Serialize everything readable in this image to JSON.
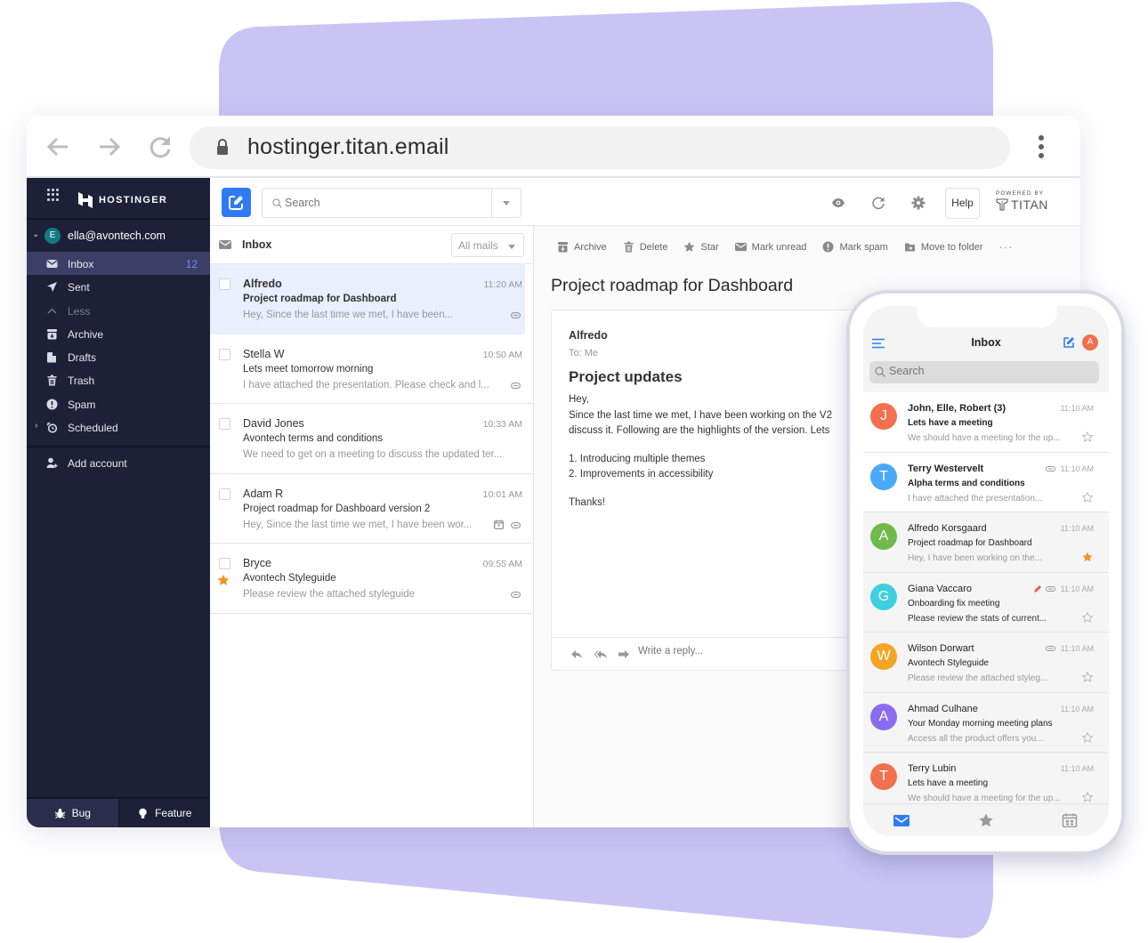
{
  "browser": {
    "url": "hostinger.titan.email",
    "nav": {
      "back": "arrow-left",
      "forward": "arrow-right",
      "reload": "reload"
    }
  },
  "sidebar": {
    "brand": "HOSTINGER",
    "account": {
      "initial": "E",
      "email": "ella@avontech.com"
    },
    "folders": [
      {
        "label": "Inbox",
        "icon": "envelope",
        "count": "12",
        "active": true
      },
      {
        "label": "Sent",
        "icon": "paper-plane"
      },
      {
        "label": "Less",
        "icon": "chevron-up"
      },
      {
        "label": "Archive",
        "icon": "archive-box"
      },
      {
        "label": "Drafts",
        "icon": "draft-page"
      },
      {
        "label": "Trash",
        "icon": "trash"
      },
      {
        "label": "Spam",
        "icon": "exclamation-circle"
      },
      {
        "label": "Scheduled",
        "icon": "alarm-clock"
      }
    ],
    "add_account": "Add account",
    "footer": {
      "bug": "Bug",
      "feature": "Feature"
    }
  },
  "toolbar": {
    "search_placeholder": "Search",
    "help": "Help",
    "powered_by": "POWERED BY",
    "titan": "TITAN"
  },
  "mail_list": {
    "title": "Inbox",
    "filter": "All mails",
    "items": [
      {
        "from": "Alfredo",
        "time": "11:20 AM",
        "subject": "Project roadmap for Dashboard",
        "preview": "Hey, Since the last time we met, I have been...",
        "attachment": true,
        "unread": true,
        "selected": true
      },
      {
        "from": "Stella W",
        "time": "10:50 AM",
        "subject": "Lets meet tomorrow morning",
        "preview": "I have attached the presentation. Please check and l...",
        "attachment": true
      },
      {
        "from": "David Jones",
        "time": "10:33 AM",
        "subject": "Avontech terms and conditions",
        "preview": "We need to get on a meeting to discuss the updated ter..."
      },
      {
        "from": "Adam R",
        "time": "10:01 AM",
        "subject": "Project roadmap for Dashboard version 2",
        "preview": "Hey, Since the last time we met, I have been wor...",
        "attachment": true,
        "calendar": true
      },
      {
        "from": "Bryce",
        "time": "09:55 AM",
        "subject": "Avontech Styleguide",
        "preview": "Please review the attached styleguide",
        "attachment": true,
        "starred": true
      }
    ]
  },
  "reader": {
    "actions": [
      "Archive",
      "Delete",
      "Star",
      "Mark unread",
      "Mark spam",
      "Move to folder"
    ],
    "subject": "Project roadmap for Dashboard",
    "from": "Alfredo",
    "to": "To: Me",
    "heading": "Project updates",
    "body": {
      "greeting": "Hey,",
      "line1": "Since the last time we met, I have been working on the V2",
      "line2": "discuss it. Following are the highlights of the version. Lets",
      "point1": "1. Introducing multiple themes",
      "point2": "2. Improvements in accessibility",
      "signoff": "Thanks!"
    },
    "reply_placeholder": "Write a reply..."
  },
  "phone": {
    "title": "Inbox",
    "avatar": "A",
    "search_placeholder": "Search",
    "items": [
      {
        "initial": "J",
        "color": "#f2704f",
        "from": "John, Elle, Robert (3)",
        "time": "11:10 AM",
        "subject": "Lets have a meeting",
        "preview": "We should have a meeting for the up...",
        "unread": true
      },
      {
        "initial": "T",
        "color": "#4aa8f7",
        "from": "Terry Westervelt",
        "time": "11:10 AM",
        "subject": "Alpha terms and conditions",
        "preview": "I have attached the presentation...",
        "unread": true,
        "attachment": true
      },
      {
        "initial": "A",
        "color": "#72b94c",
        "from": "Alfredo Korsgaard",
        "time": "11:10 AM",
        "subject": "Project roadmap for Dashboard",
        "preview": "Hey, I have been working on the...",
        "starred": true
      },
      {
        "initial": "G",
        "color": "#3ed0de",
        "from": "Giana Vaccaro",
        "time": "11:10 AM",
        "subject": "Onboarding fix meeting",
        "preview": "Please review the stats of current...",
        "attachment": true,
        "draft": true
      },
      {
        "initial": "W",
        "color": "#f5a524",
        "from": "Wilson Dorwart",
        "time": "11:10 AM",
        "subject": "Avontech Styleguide",
        "preview": "Please review the attached styleg...",
        "attachment": true
      },
      {
        "initial": "A",
        "color": "#8b6cf0",
        "from": "Ahmad Culhane",
        "time": "11:10 AM",
        "subject": "Your Monday morning meeting plans",
        "preview": "Access all the product offers you..."
      },
      {
        "initial": "T",
        "color": "#f2704f",
        "from": "Terry Lubin",
        "time": "11:10 AM",
        "subject": "Lets have a meeting",
        "preview": "We should have a meeting for the up..."
      }
    ],
    "tabs": [
      "mail",
      "starred",
      "calendar"
    ]
  },
  "colors": {
    "accent": "#2f7bf5",
    "sidebar_bg": "#1d2036",
    "sidebar_active": "#3b3f66",
    "backdrop": "#c8c5f5",
    "star": "#f5921e"
  }
}
